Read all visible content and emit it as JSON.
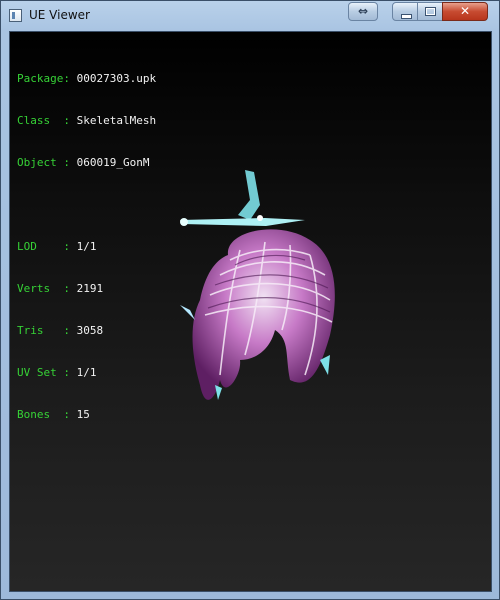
{
  "window": {
    "title": "UE Viewer"
  },
  "info": [
    {
      "label": "Package",
      "value": "00027303.upk"
    },
    {
      "label": "Class  ",
      "value": "SkeletalMesh"
    },
    {
      "label": "Object ",
      "value": "060019_GonM"
    },
    {
      "label": "LOD    ",
      "value": "1/1"
    },
    {
      "label": "Verts  ",
      "value": "2191"
    },
    {
      "label": "Tris   ",
      "value": "3058"
    },
    {
      "label": "UV Set ",
      "value": "1/1"
    },
    {
      "label": "Bones  ",
      "value": "15"
    }
  ],
  "colors": {
    "label": "#36d236",
    "value": "#f2f2f2",
    "hair_main": "#c77ac7",
    "hair_accent": "#7de0e8"
  }
}
